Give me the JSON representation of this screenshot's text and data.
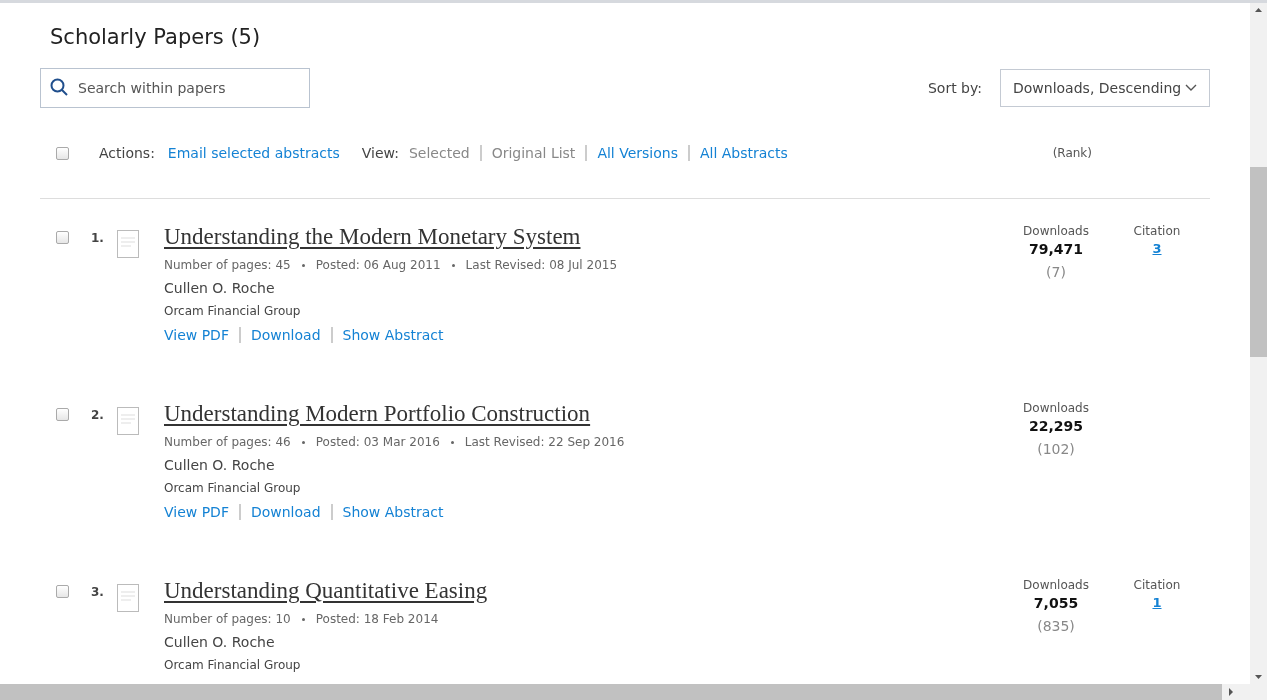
{
  "heading": "Scholarly Papers (5)",
  "search": {
    "placeholder": "Search within papers"
  },
  "sort": {
    "label": "Sort by:",
    "value": "Downloads, Descending"
  },
  "actions_bar": {
    "checked": false,
    "actions_label": "Actions:",
    "action_link": "Email selected abstracts",
    "view_label": "View:",
    "view_items": [
      {
        "label": "Selected",
        "disabled": true
      },
      {
        "label": "Original List",
        "disabled": true
      },
      {
        "label": "All Versions",
        "disabled": false
      },
      {
        "label": "All Abstracts",
        "disabled": false
      }
    ],
    "rank_label": "(Rank)"
  },
  "papers": [
    {
      "checked": false,
      "number": "1.",
      "title": "Understanding the Modern Monetary System",
      "meta": [
        "Number of pages: 45",
        "Posted: 06 Aug 2011",
        "Last Revised: 08 Jul 2015"
      ],
      "author": "Cullen O. Roche",
      "affiliation": "Orcam Financial Group",
      "links": [
        "View PDF",
        "Download",
        "Show Abstract"
      ],
      "downloads_label": "Downloads",
      "downloads": "79,471",
      "rank": "(7)",
      "citation_label": "Citation",
      "citations": "3"
    },
    {
      "checked": false,
      "number": "2.",
      "title": "Understanding Modern Portfolio Construction",
      "meta": [
        "Number of pages: 46",
        "Posted: 03 Mar 2016",
        "Last Revised: 22 Sep 2016"
      ],
      "author": "Cullen O. Roche",
      "affiliation": "Orcam Financial Group",
      "links": [
        "View PDF",
        "Download",
        "Show Abstract"
      ],
      "downloads_label": "Downloads",
      "downloads": "22,295",
      "rank": "(102)"
    },
    {
      "checked": false,
      "number": "3.",
      "title": "Understanding Quantitative Easing",
      "meta": [
        "Number of pages: 10",
        "Posted: 18 Feb 2014"
      ],
      "author": "Cullen O. Roche",
      "affiliation": "Orcam Financial Group",
      "downloads_label": "Downloads",
      "downloads": "7,055",
      "rank": "(835)",
      "citation_label": "Citation",
      "citations": "1"
    }
  ]
}
